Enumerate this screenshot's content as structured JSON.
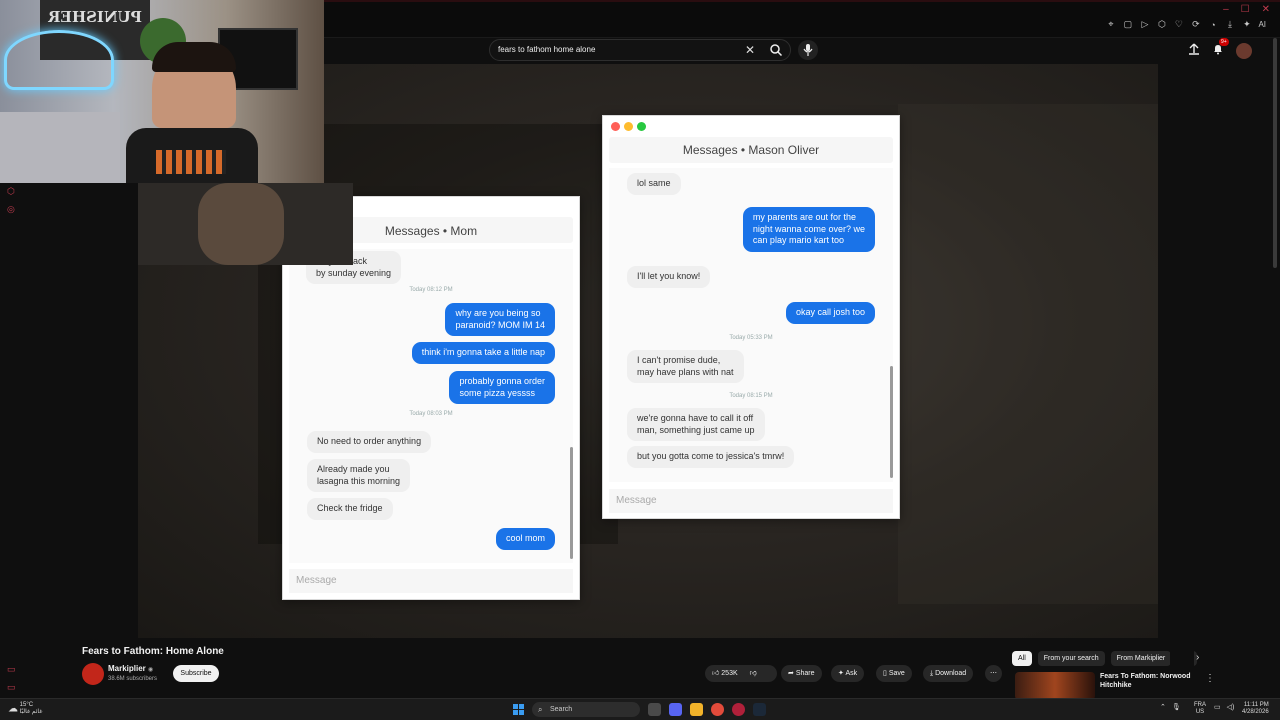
{
  "browser": {
    "toolbar_ai_label": "AI"
  },
  "youtube": {
    "search": {
      "value": "fears to fathom home alone",
      "placeholder": "Search"
    },
    "notifications_badge": "9+",
    "video": {
      "title": "Fears to Fathom: Home Alone",
      "channel": "Markiplier",
      "verified_mark": "◉",
      "subscribers": "38.6M subscribers",
      "subscribe_label": "Subscribe",
      "likes": "253K",
      "share_label": "Share",
      "ask_label": "Ask",
      "save_label": "Save",
      "download_label": "Download"
    },
    "chips": [
      "All",
      "From your search",
      "From Markiplier",
      "Fe"
    ],
    "recommended": {
      "title": "Fears To Fathom: Norwood Hitchhike"
    }
  },
  "webcam": {
    "poster_text": "PUNISHER"
  },
  "game": {
    "mom_chat": {
      "title": "Messages • Mom",
      "messages": [
        {
          "dir": "in",
          "text": "may be back\nby sunday evening"
        },
        {
          "dir": "ts",
          "text": "Today 08:12 PM"
        },
        {
          "dir": "out",
          "text": "why are you being so\nparanoid? MOM IM 14"
        },
        {
          "dir": "out",
          "text": "think i'm gonna take a little nap"
        },
        {
          "dir": "out",
          "text": "probably gonna order\nsome pizza yessss"
        },
        {
          "dir": "ts",
          "text": "Today 08:03 PM"
        },
        {
          "dir": "in",
          "text": "No need to order anything"
        },
        {
          "dir": "in",
          "text": "Already made you\nlasagna this morning"
        },
        {
          "dir": "in",
          "text": "Check the fridge"
        },
        {
          "dir": "out",
          "text": "cool mom"
        }
      ],
      "input_placeholder": "Message"
    },
    "mason_chat": {
      "title": "Messages • Mason Oliver",
      "messages": [
        {
          "dir": "in",
          "text": "lol same"
        },
        {
          "dir": "out",
          "text": "my parents are out for the\nnight wanna come over? we\ncan play mario kart too"
        },
        {
          "dir": "in",
          "text": "I'll let you know!"
        },
        {
          "dir": "out",
          "text": "okay call josh too"
        },
        {
          "dir": "ts",
          "text": "Today 05:33 PM"
        },
        {
          "dir": "in",
          "text": "I can't promise dude,\nmay have plans with nat"
        },
        {
          "dir": "ts",
          "text": "Today 08:15 PM"
        },
        {
          "dir": "in",
          "text": "we're gonna have to call it off\nman, something just came up"
        },
        {
          "dir": "in",
          "text": "but you gotta come to jessica's tmrw!"
        }
      ],
      "input_placeholder": "Message"
    }
  },
  "taskbar": {
    "weather_temp": "15°C",
    "weather_desc": "غائم غالبًا",
    "search_label": "Search",
    "lang_top": "FRA",
    "lang_bottom": "US",
    "time": "11:11 PM",
    "date": "4/28/2026"
  },
  "colors": {
    "bubble_out": "#1a73e8",
    "bubble_in": "#efefef",
    "accent_red": "#c23b4e"
  }
}
